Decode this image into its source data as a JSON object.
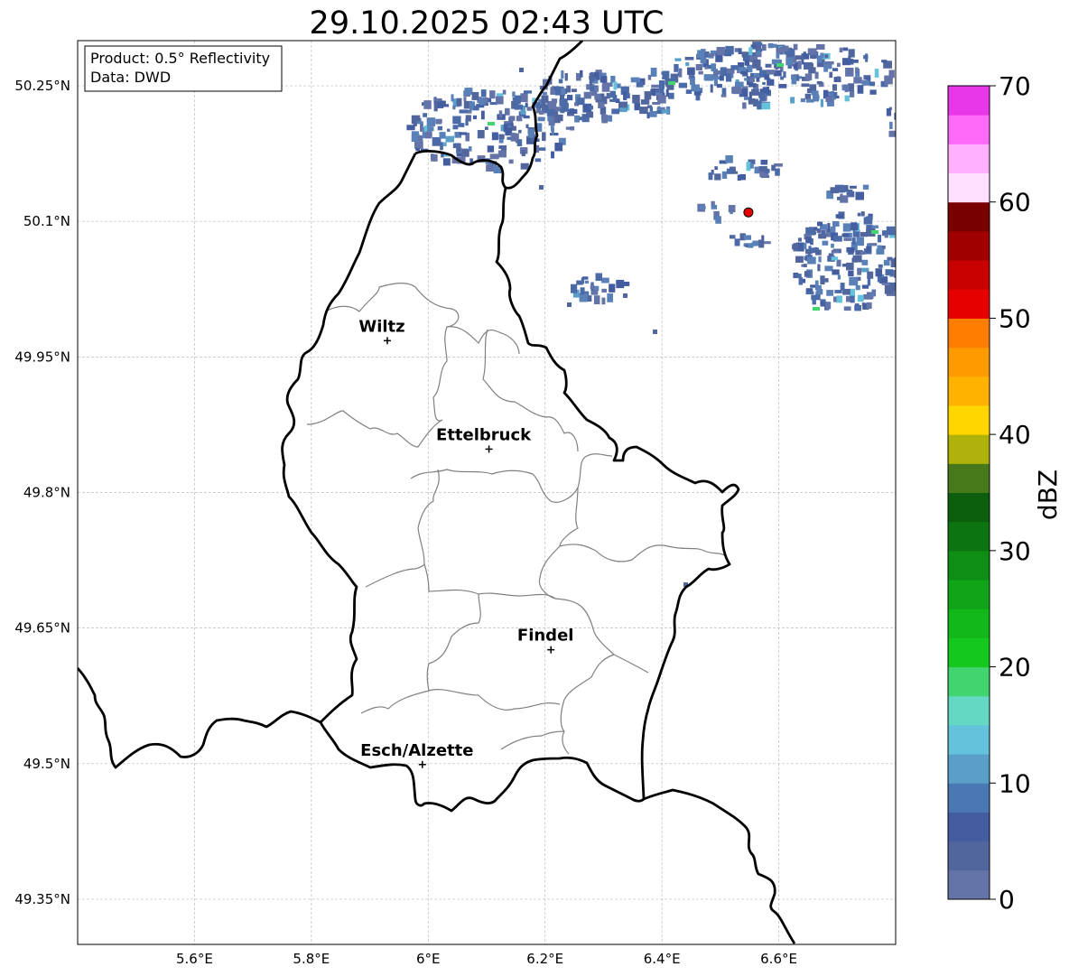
{
  "title": "29.10.2025 02:43 UTC",
  "info_box": {
    "product": "Product: 0.5° Reflectivity",
    "data_source": "Data: DWD"
  },
  "map": {
    "lon_range": [
      5.4,
      6.8
    ],
    "lat_range": [
      49.3,
      50.3
    ],
    "x_ticks": [
      {
        "value": 5.6,
        "label": "5.6°E"
      },
      {
        "value": 5.8,
        "label": "5.8°E"
      },
      {
        "value": 6.0,
        "label": "6°E"
      },
      {
        "value": 6.2,
        "label": "6.2°E"
      },
      {
        "value": 6.4,
        "label": "6.4°E"
      },
      {
        "value": 6.6,
        "label": "6.6°E"
      }
    ],
    "y_ticks": [
      {
        "value": 50.25,
        "label": "50.25°N"
      },
      {
        "value": 50.1,
        "label": "50.1°N"
      },
      {
        "value": 49.95,
        "label": "49.95°N"
      },
      {
        "value": 49.8,
        "label": "49.8°N"
      },
      {
        "value": 49.65,
        "label": "49.65°N"
      },
      {
        "value": 49.5,
        "label": "49.5°N"
      },
      {
        "value": 49.35,
        "label": "49.35°N"
      }
    ],
    "grid": true,
    "cities": [
      {
        "name": "Wiltz",
        "lon": 5.93,
        "lat": 49.968
      },
      {
        "name": "Ettelbruck",
        "lon": 6.104,
        "lat": 49.848
      },
      {
        "name": "Findel",
        "lon": 6.21,
        "lat": 49.626
      },
      {
        "name": "Esch/Alzette",
        "lon": 5.99,
        "lat": 49.499
      }
    ],
    "radar_site": {
      "lon": 6.548,
      "lat": 50.11
    }
  },
  "colorbar": {
    "label": "dBZ",
    "min": 0,
    "max": 70,
    "step": 2.5,
    "tick_values": [
      0,
      10,
      20,
      30,
      40,
      50,
      60,
      70
    ],
    "tick_labels": [
      "0",
      "10",
      "20",
      "30",
      "40",
      "50",
      "60",
      "70"
    ],
    "colors": [
      "#6474a8",
      "#52669e",
      "#435da0",
      "#4a78b2",
      "#5a9fc8",
      "#64c2dc",
      "#64d8c2",
      "#42d46e",
      "#14c81e",
      "#12b81a",
      "#10a418",
      "#0e8e14",
      "#0c7410",
      "#0a5e0c",
      "#47781a",
      "#afb20a",
      "#ffd600",
      "#ffb300",
      "#ff9a00",
      "#ff7d00",
      "#e60000",
      "#c80000",
      "#a00000",
      "#780000",
      "#ffe0ff",
      "#ffb0ff",
      "#ff6af8",
      "#e837e8"
    ]
  }
}
